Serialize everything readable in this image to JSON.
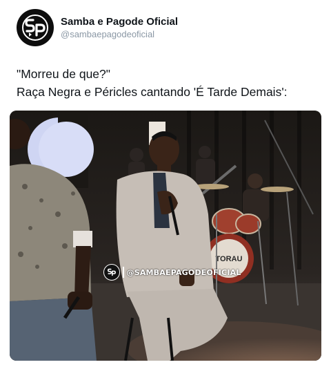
{
  "author": {
    "display_name": "Samba e Pagode Oficial",
    "handle": "@sambaepagodeoficial",
    "avatar_icon": "sp-logo-icon"
  },
  "tweet": {
    "line1": "\"Morreu de que?\"",
    "line2": "Raça Negra e Péricles cantando 'É Tarde Demais':"
  },
  "media": {
    "watermark": "@SAMBAEPAGODEOFICIAL",
    "drum_text": "TORAU"
  },
  "colors": {
    "text": "#0f1419",
    "secondary": "#8b98a5",
    "media_bg": "#1a1714"
  }
}
